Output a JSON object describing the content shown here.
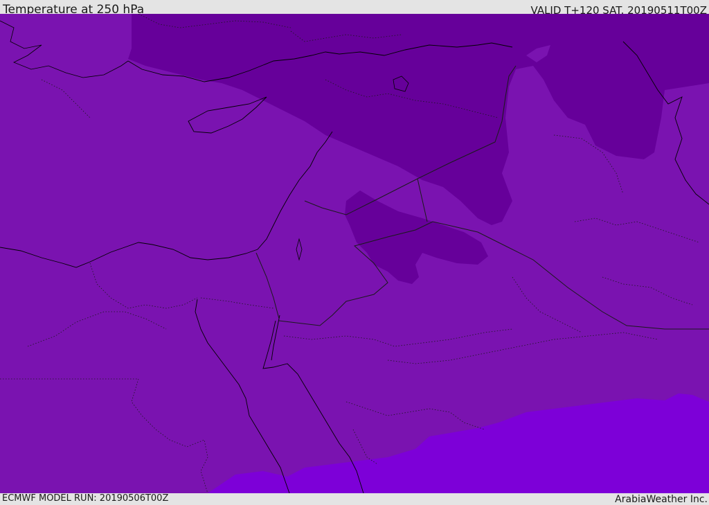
{
  "header": {
    "title": "Temperature at 250 hPa",
    "valid": "VALID T+120 SAT. 20190511T00Z"
  },
  "footer": {
    "model_run": "ECMWF MODEL RUN: 20190506T00Z",
    "credit": "ArabiaWeather Inc."
  },
  "colors": {
    "background_bar": "#e4e4e4",
    "field_base": "#7a13b0",
    "field_cold": "#66009a",
    "field_warm": "#7d00d8",
    "coastline": "#000000",
    "border": "#1a1a1a"
  }
}
